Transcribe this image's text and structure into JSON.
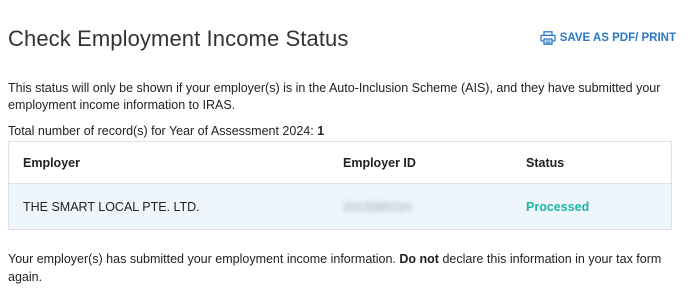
{
  "header": {
    "title": "Check Employment Income Status",
    "save_label": "SAVE AS PDF/ PRINT",
    "save_icon": "printer-icon",
    "accent_color": "#2a78c6"
  },
  "intro_text": "This status will only be shown if your employer(s) is in the Auto-Inclusion Scheme (AIS), and they have submitted your employment income information to IRAS.",
  "records": {
    "label": "Total number of record(s) for Year of Assessment 2024:",
    "count": "1"
  },
  "table": {
    "headers": {
      "employer": "Employer",
      "employer_id": "Employer ID",
      "status": "Status"
    },
    "rows": [
      {
        "employer": "THE SMART LOCAL PTE. LTD.",
        "employer_id": "201328021H",
        "status": "Processed",
        "status_color": "#22b5a4"
      }
    ]
  },
  "footer": {
    "part1": "Your employer(s) has submitted your employment income information.",
    "emphasis": "Do not",
    "part2": "declare this information in your tax form again."
  }
}
